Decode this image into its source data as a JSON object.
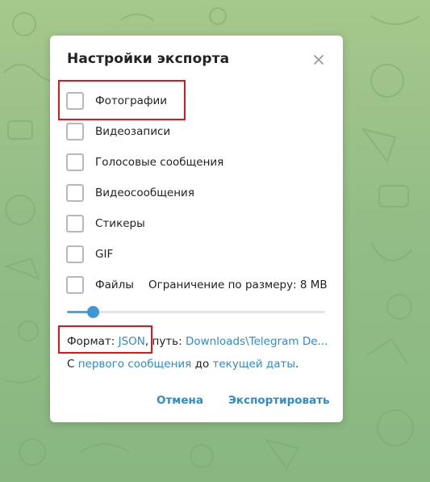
{
  "dialog": {
    "title": "Настройки экспорта",
    "close_icon": "close-icon"
  },
  "options": [
    {
      "label": "Фотографии",
      "checked": false
    },
    {
      "label": "Видеозаписи",
      "checked": false
    },
    {
      "label": "Голосовые сообщения",
      "checked": false
    },
    {
      "label": "Видеосообщения",
      "checked": false
    },
    {
      "label": "Стикеры",
      "checked": false
    },
    {
      "label": "GIF",
      "checked": false
    },
    {
      "label": "Файлы",
      "checked": false
    }
  ],
  "size_limit": {
    "label": "Ограничение по размеру: 8 MB",
    "slider_fraction": 0.1
  },
  "format": {
    "prefix": "Формат:",
    "value": "JSON",
    "separator": ", путь:",
    "path": "Downloads\\Telegram De..."
  },
  "range": {
    "prefix": "С",
    "from_link": "первого сообщения",
    "middle": "до",
    "to_link": "текущей даты",
    "suffix": "."
  },
  "buttons": {
    "cancel": "Отмена",
    "export": "Экспортировать"
  },
  "colors": {
    "accent": "#2f8bcc",
    "slider": "#3d97d6",
    "highlight": "#e0141b",
    "background": "#9cbf85"
  }
}
